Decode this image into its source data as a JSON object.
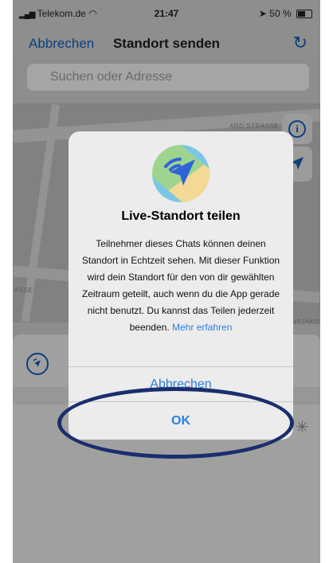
{
  "status_bar": {
    "carrier": "Telekom.de",
    "time": "21:47",
    "battery": "50 %"
  },
  "nav": {
    "cancel_label": "Abbrechen",
    "title": "Standort senden",
    "refresh_icon": "refresh-icon"
  },
  "search": {
    "placeholder": "Suchen oder Adresse"
  },
  "map": {
    "street_1": "ARD STRASSE",
    "street_2": "ASSE",
    "street_3": "HANSJAKOB"
  },
  "alert": {
    "title": "Live-Standort teilen",
    "message": "Teilnehmer dieses Chats können deinen Standort in Echtzeit sehen. Mit dieser Funktion wird dein Standort für den von dir gewählten Zeitraum geteilt, auch wenn du die App gerade nicht benutzt. Du kannst das Teilen jederzeit beenden.",
    "link": "Mehr erfahren",
    "cancel_label": "Abbrechen",
    "ok_label": "OK"
  },
  "colors": {
    "accent": "#2b80e0",
    "highlight_ring": "#1a2e6e"
  }
}
